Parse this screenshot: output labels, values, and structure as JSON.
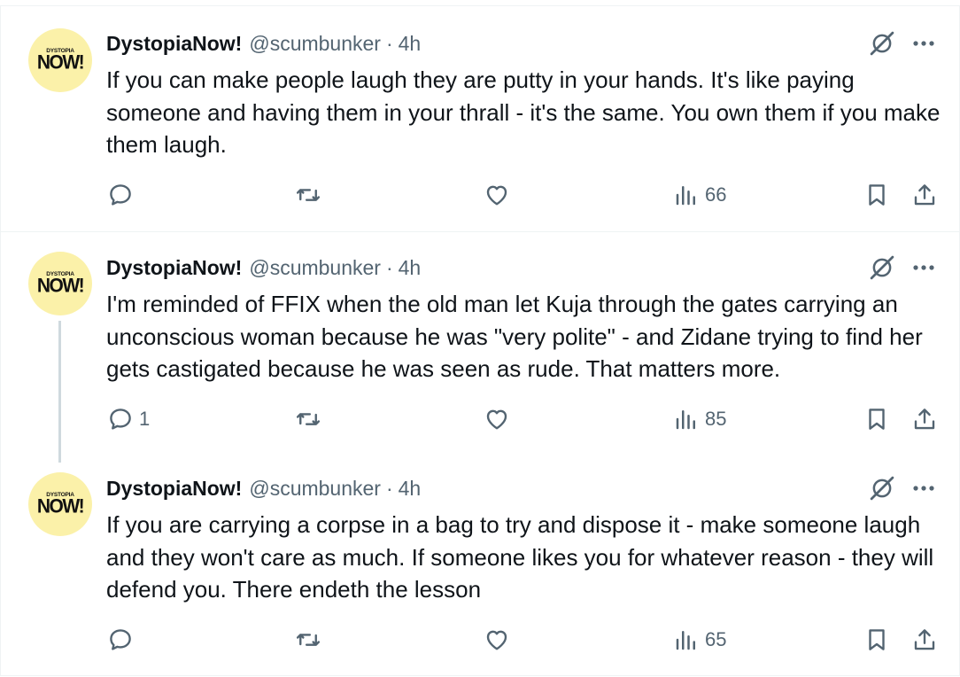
{
  "tweets": [
    {
      "name": "DystopiaNow!",
      "handle": "@scumbunker",
      "separator": "·",
      "time": "4h",
      "avatar": {
        "line1": "DYSTOPIA",
        "line2": "NOW!"
      },
      "text": "If you can make people laugh they are putty in your hands. It's like paying someone and having them in your thrall - it's the same. You own them if you make them laugh.",
      "replies": "",
      "reposts": "",
      "likes": "",
      "views": "66"
    },
    {
      "name": "DystopiaNow!",
      "handle": "@scumbunker",
      "separator": "·",
      "time": "4h",
      "avatar": {
        "line1": "DYSTOPIA",
        "line2": "NOW!"
      },
      "text": "I'm reminded of FFIX when the old man let Kuja through the gates carrying an unconscious woman because he was \"very polite\" - and Zidane trying to find her gets castigated because he was seen as rude. That matters more.",
      "replies": "1",
      "reposts": "",
      "likes": "",
      "views": "85"
    },
    {
      "name": "DystopiaNow!",
      "handle": "@scumbunker",
      "separator": "·",
      "time": "4h",
      "avatar": {
        "line1": "DYSTOPIA",
        "line2": "NOW!"
      },
      "text": "If you are carrying a corpse in a bag to try and dispose it - make someone laugh and they won't care as much. If someone likes you for whatever reason - they will defend you. There endeth the lesson",
      "replies": "",
      "reposts": "",
      "likes": "",
      "views": "65"
    }
  ],
  "icons": {
    "reply": "reply-icon",
    "repost": "repost-icon",
    "like": "like-icon",
    "views": "views-icon",
    "bookmark": "bookmark-icon",
    "share": "share-icon",
    "grok": "grok-icon",
    "more": "more-icon"
  },
  "colors": {
    "text": "#0f1419",
    "secondary": "#536471",
    "border": "#eff3f4",
    "thread_line": "#cfd9de",
    "avatar_bg": "#fbf1a9"
  }
}
